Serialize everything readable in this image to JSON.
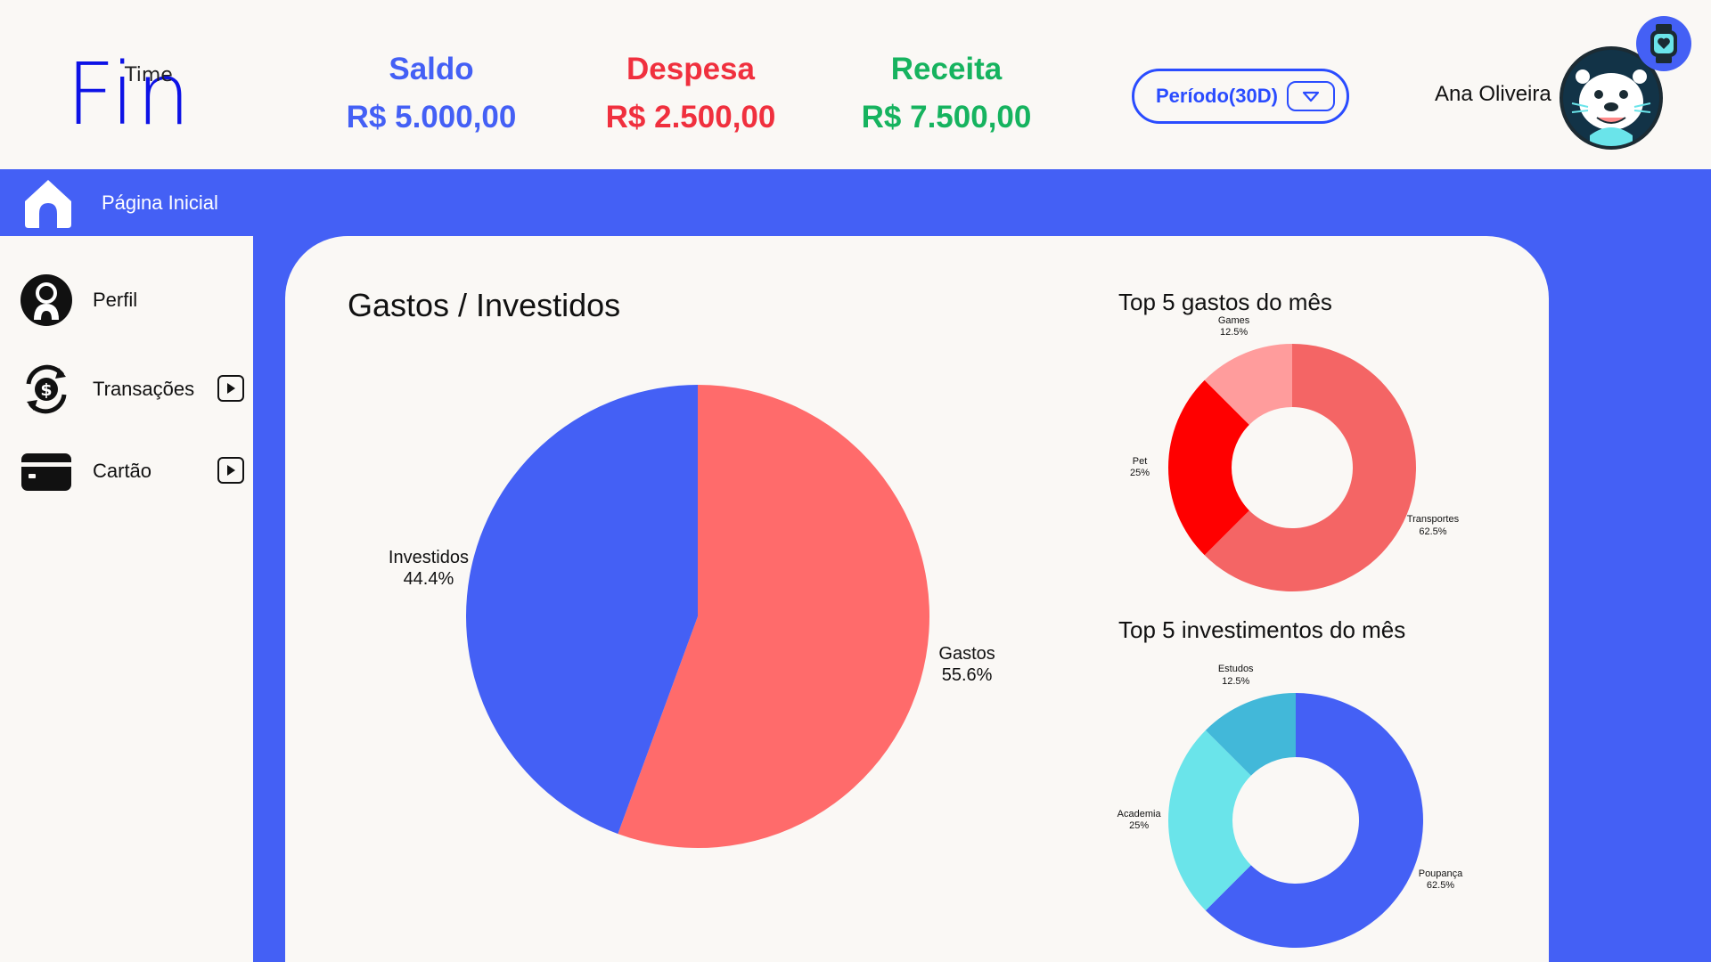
{
  "app": {
    "logo_main": "Fin",
    "logo_super": "Time"
  },
  "header": {
    "stats": [
      {
        "label": "Saldo",
        "value": "R$ 5.000,00",
        "color": "#4460f5"
      },
      {
        "label": "Despesa",
        "value": "R$ 2.500,00",
        "color": "#f0303e"
      },
      {
        "label": "Receita",
        "value": "R$ 7.500,00",
        "color": "#16b35f"
      }
    ],
    "period_label": "Período(30D)",
    "user_name": "Ana Oliveira"
  },
  "nav": {
    "home_label": "Página Inicial"
  },
  "sidebar": {
    "items": [
      {
        "label": "Perfil",
        "icon": "profile-icon"
      },
      {
        "label": "Transações",
        "icon": "money-exchange-icon"
      },
      {
        "label": "Cartão",
        "icon": "card-icon"
      }
    ]
  },
  "main": {
    "title": "Gastos / Investidos"
  },
  "chart_data": [
    {
      "type": "pie",
      "title": "",
      "categories": [
        "Gastos",
        "Investidos"
      ],
      "values": [
        55.6,
        44.4
      ],
      "labels": [
        "55.6%",
        "44.4%"
      ],
      "colors": [
        "#ff6b6b",
        "#4460f5"
      ]
    },
    {
      "type": "pie",
      "title": "Top 5 gastos do mês",
      "categories": [
        "Transportes",
        "Pet",
        "Games"
      ],
      "values": [
        62.5,
        25,
        12.5
      ],
      "labels": [
        "62.5%",
        "25%",
        "12.5%"
      ],
      "colors": [
        "#f46565",
        "#ff0000",
        "#ff9c9c"
      ]
    },
    {
      "type": "pie",
      "title": "Top 5  investimentos do mês",
      "categories": [
        "Poupança",
        "Academia",
        "Estudos"
      ],
      "values": [
        62.5,
        25,
        12.5
      ],
      "labels": [
        "62.5%",
        "25%",
        "12.5%"
      ],
      "colors": [
        "#4460f5",
        "#6ae4ea",
        "#42b8d9"
      ]
    }
  ]
}
